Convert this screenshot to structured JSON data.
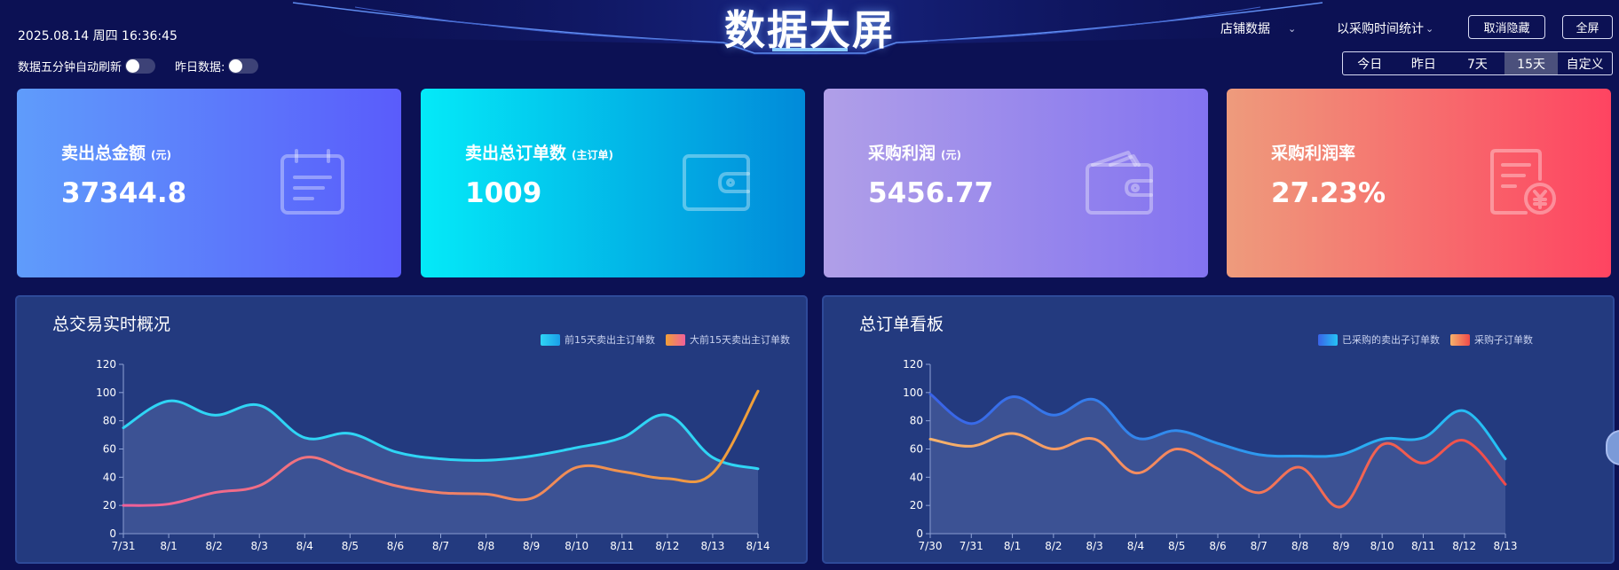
{
  "header": {
    "title": "数据大屏",
    "datetime": "2025.08.14 周四 16:36:45",
    "auto_refresh_label": "数据五分钟自动刷新",
    "yesterday_label": "昨日数据:",
    "store_dropdown": "店铺数据",
    "stat_dropdown": "以采购时间统计",
    "hide_button": "取消隐藏",
    "fullscreen_button": "全屏",
    "ranges": [
      "今日",
      "昨日",
      "7天",
      "15天",
      "自定义"
    ],
    "active_range": "15天"
  },
  "cards": [
    {
      "label": "卖出总金额",
      "unit": "(元)",
      "value": "37344.8",
      "icon": "calendar-icon"
    },
    {
      "label": "卖出总订单数",
      "unit": "(主订单)",
      "value": "1009",
      "icon": "wallet-icon"
    },
    {
      "label": "采购利润",
      "unit": "(元)",
      "value": "5456.77",
      "icon": "purse-icon"
    },
    {
      "label": "采购利润率",
      "unit": "",
      "value": "27.23%",
      "icon": "invoice-yen-icon"
    }
  ],
  "chart_data": [
    {
      "type": "line",
      "title": "总交易实时概况",
      "x": [
        "7/31",
        "8/1",
        "8/2",
        "8/3",
        "8/4",
        "8/5",
        "8/6",
        "8/7",
        "8/8",
        "8/9",
        "8/10",
        "8/11",
        "8/12",
        "8/13",
        "8/14"
      ],
      "ylim": [
        0,
        120
      ],
      "yticks": [
        0,
        20,
        40,
        60,
        80,
        100,
        120
      ],
      "grid": false,
      "legend": "top-right",
      "series": [
        {
          "name": "前15天卖出主订单数",
          "color": "#2fd5f5",
          "values": [
            75,
            94,
            84,
            91,
            68,
            71,
            58,
            53,
            52,
            55,
            61,
            68,
            84,
            54,
            46
          ],
          "area": true
        },
        {
          "name": "大前15天卖出主订单数",
          "color": "#f0609a",
          "color_end": "#f0a038",
          "values": [
            20,
            21,
            29,
            34,
            54,
            44,
            34,
            29,
            28,
            25,
            47,
            44,
            39,
            43,
            101
          ],
          "area": false
        }
      ]
    },
    {
      "type": "line",
      "title": "总订单看板",
      "x": [
        "7/30",
        "7/31",
        "8/1",
        "8/2",
        "8/3",
        "8/4",
        "8/5",
        "8/6",
        "8/7",
        "8/8",
        "8/9",
        "8/10",
        "8/11",
        "8/12",
        "8/13"
      ],
      "ylim": [
        0,
        120
      ],
      "yticks": [
        0,
        20,
        40,
        60,
        80,
        100,
        120
      ],
      "grid": false,
      "legend": "top-right",
      "series": [
        {
          "name": "已采购的卖出子订单数",
          "color": "#3a63e8",
          "color_end": "#24c3f5",
          "values": [
            99,
            78,
            97,
            84,
            95,
            68,
            73,
            64,
            56,
            55,
            56,
            67,
            68,
            87,
            53
          ],
          "area": true
        },
        {
          "name": "采购子订单数",
          "color": "#f6b26b",
          "color_end": "#f04a4a",
          "values": [
            67,
            62,
            71,
            60,
            67,
            43,
            60,
            46,
            29,
            47,
            19,
            63,
            50,
            66,
            35
          ],
          "area": false
        }
      ]
    }
  ]
}
